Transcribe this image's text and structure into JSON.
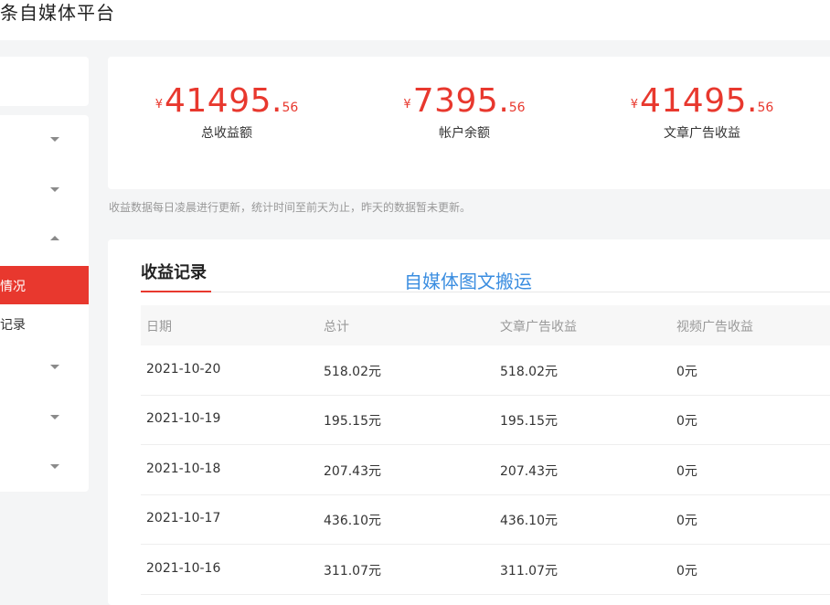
{
  "app": {
    "title": "条自媒体平台"
  },
  "sidebar": {
    "active_item": "情况",
    "sub_item": "记录"
  },
  "stats": [
    {
      "currency": "¥",
      "integer": "41495",
      "decimal": "56",
      "label": "总收益额"
    },
    {
      "currency": "¥",
      "integer": "7395",
      "decimal": "56",
      "label": "帐户余额"
    },
    {
      "currency": "¥",
      "integer": "41495",
      "decimal": "56",
      "label": "文章广告收益"
    }
  ],
  "note": "收益数据每日凌晨进行更新，统计时间至前天为止，昨天的数据暂未更新。",
  "records": {
    "title": "收益记录",
    "overlay_text": "自媒体图文搬运",
    "columns": [
      "日期",
      "总计",
      "文章广告收益",
      "视频广告收益"
    ],
    "rows": [
      [
        "2021-10-20",
        "518.02元",
        "518.02元",
        "0元"
      ],
      [
        "2021-10-19",
        "195.15元",
        "195.15元",
        "0元"
      ],
      [
        "2021-10-18",
        "207.43元",
        "207.43元",
        "0元"
      ],
      [
        "2021-10-17",
        "436.10元",
        "436.10元",
        "0元"
      ],
      [
        "2021-10-16",
        "311.07元",
        "311.07元",
        "0元"
      ]
    ]
  },
  "colors": {
    "accent": "#e8382e",
    "overlay": "#3a8de0"
  }
}
